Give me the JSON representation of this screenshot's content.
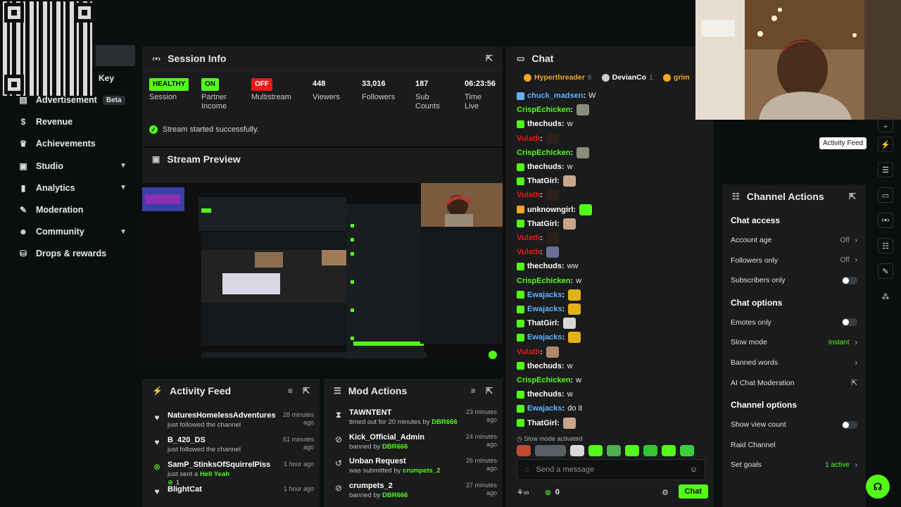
{
  "colors": {
    "accent": "#53fc18",
    "bg": "#0b0e0f",
    "panel": "#191b1c",
    "offline": "#e91916"
  },
  "sidebar": {
    "stream_key": "Key",
    "items": [
      {
        "label": "Advertisement",
        "icon": "advertisement-icon",
        "badge": "Beta"
      },
      {
        "label": "Revenue",
        "icon": "dollar-icon"
      },
      {
        "label": "Achievements",
        "icon": "trophy-icon"
      },
      {
        "label": "Studio",
        "icon": "studio-icon",
        "expandable": true
      },
      {
        "label": "Analytics",
        "icon": "chart-icon",
        "expandable": true
      },
      {
        "label": "Moderation",
        "icon": "wrench-icon"
      },
      {
        "label": "Community",
        "icon": "people-icon",
        "expandable": true
      },
      {
        "label": "Drops & rewards",
        "icon": "gift-icon"
      }
    ]
  },
  "session": {
    "title": "Session Info",
    "stats": [
      {
        "value": "HEALTHY",
        "label": "Session",
        "style": "green"
      },
      {
        "value": "ON",
        "label": "Partner Income",
        "style": "green"
      },
      {
        "value": "OFF",
        "label": "Multistream",
        "style": "red"
      },
      {
        "value": "448",
        "label": "Viewers"
      },
      {
        "value": "33,016",
        "label": "Followers"
      },
      {
        "value": "187",
        "label": "Sub Counts"
      },
      {
        "value": "06:23:56",
        "label": "Time Live"
      }
    ],
    "status": "Stream started successfully."
  },
  "preview": {
    "title": "Stream Preview"
  },
  "activity": {
    "title": "Activity Feed",
    "items": [
      {
        "icon": "heart-icon",
        "name": "NaturesHomelessAdventures",
        "sub": "just followed the channel",
        "time": "28 minutes ago"
      },
      {
        "icon": "heart-icon",
        "name": "B_420_DS",
        "sub": "just followed the channel",
        "time": "51 minutes ago"
      },
      {
        "icon": "kick-icon",
        "name": "SamP_StinksOfSquirrelPiss",
        "sub_prefix": "just sent a ",
        "sub_highlight": "Hell Yeah",
        "extra": "1",
        "time": "1 hour ago"
      },
      {
        "icon": "heart-icon",
        "name": "BlightCat",
        "sub": "",
        "time": "1 hour ago"
      }
    ]
  },
  "mod": {
    "title": "Mod Actions",
    "items": [
      {
        "icon": "hourglass-icon",
        "name": "TAWNTENT",
        "sub_prefix": "timed out for 20 minutes by ",
        "by": "DBR666",
        "time": "23 minutes ago"
      },
      {
        "icon": "ban-icon",
        "name": "Kick_Official_Admin",
        "sub_prefix": "banned by ",
        "by": "DBR666",
        "time": "24 minutes ago"
      },
      {
        "icon": "undo-icon",
        "name": "Unban Request",
        "sub_prefix": "was submitted by ",
        "by": "crumpets_2",
        "time": "26 minutes ago"
      },
      {
        "icon": "ban-icon",
        "name": "crumpets_2",
        "sub_prefix": "banned by ",
        "by": "DBR666",
        "time": "27 minutes ago"
      }
    ]
  },
  "chat": {
    "title": "Chat",
    "top": [
      {
        "name": "Hyperthreader",
        "count": "6",
        "color": "#f5a623"
      },
      {
        "name": "DevianCo",
        "count": "1",
        "color": "#cccccc"
      },
      {
        "name": "grim",
        "count": "",
        "color": "#f5a623"
      }
    ],
    "messages": [
      {
        "user": "chuck_madsen",
        "color": "#5fb3ff",
        "text": "W",
        "badge": "#6ab0ff"
      },
      {
        "user": "CrispEchicken",
        "color": "#53fc18",
        "text": "",
        "emote": "#8c8c7a"
      },
      {
        "user": "thechuds",
        "color": "#ffffff",
        "text": "w",
        "badge": "#53fc18"
      },
      {
        "user": "Vulath",
        "color": "#e91916",
        "text": "",
        "emote": "#2b2019"
      },
      {
        "user": "CrispEchicken",
        "color": "#53fc18",
        "text": "",
        "emote": "#8c8c7a"
      },
      {
        "user": "thechuds",
        "color": "#ffffff",
        "text": "w",
        "badge": "#53fc18"
      },
      {
        "user": "ThatGirl",
        "color": "#ffffff",
        "text": "",
        "emote": "#c9a68a",
        "badge": "#53fc18"
      },
      {
        "user": "Vulath",
        "color": "#e91916",
        "text": "",
        "emote": "#2b2019"
      },
      {
        "user": "unknowngirl",
        "color": "#ffffff",
        "text": "",
        "emote": "#53fc18",
        "badge": "#f5a623"
      },
      {
        "user": "ThatGirl",
        "color": "#ffffff",
        "text": "",
        "emote": "#c9a68a",
        "badge": "#53fc18"
      },
      {
        "user": "Vulath",
        "color": "#e91916",
        "text": "",
        "emote": "#2b2019"
      },
      {
        "user": "Vulath",
        "color": "#e91916",
        "text": "",
        "emote": "#6a6f95"
      },
      {
        "user": "thechuds",
        "color": "#ffffff",
        "text": "ww",
        "badge": "#53fc18"
      },
      {
        "user": "CrispEchicken",
        "color": "#53fc18",
        "text": "w"
      },
      {
        "user": "Ewajacks",
        "color": "#5fb3ff",
        "text": "",
        "emote": "#e3b21a",
        "badge": "#53fc18"
      },
      {
        "user": "Ewajacks",
        "color": "#5fb3ff",
        "text": "",
        "emote": "#e3b21a",
        "badge": "#53fc18"
      },
      {
        "user": "ThatGirl",
        "color": "#ffffff",
        "text": "",
        "emote": "#d8d8d8",
        "badge": "#53fc18"
      },
      {
        "user": "Ewajacks",
        "color": "#5fb3ff",
        "text": "",
        "emote": "#e3b21a",
        "badge": "#53fc18"
      },
      {
        "user": "Vulath",
        "color": "#e91916",
        "text": "",
        "emote": "#b28866"
      },
      {
        "user": "thechuds",
        "color": "#ffffff",
        "text": "w",
        "badge": "#53fc18"
      },
      {
        "user": "CrispEchicken",
        "color": "#53fc18",
        "text": "w"
      },
      {
        "user": "thechuds",
        "color": "#ffffff",
        "text": "w",
        "badge": "#53fc18"
      },
      {
        "user": "Ewajacks",
        "color": "#5fb3ff",
        "text": "do it",
        "badge": "#53fc18"
      },
      {
        "user": "ThatGirl",
        "color": "#ffffff",
        "text": "",
        "emote": "#c9a68a",
        "badge": "#53fc18"
      }
    ],
    "slow_mode": "Slow mode activated",
    "placeholder": "Send a message",
    "kicks": "0",
    "send_label": "Chat"
  },
  "actions": {
    "title": "Channel Actions",
    "sections": [
      {
        "title": "Chat access",
        "rows": [
          {
            "label": "Account age",
            "value": "Off",
            "kind": "arrow"
          },
          {
            "label": "Followers only",
            "value": "Off",
            "kind": "arrow"
          },
          {
            "label": "Subscribers only",
            "kind": "toggle"
          }
        ]
      },
      {
        "title": "Chat options",
        "rows": [
          {
            "label": "Emotes only",
            "kind": "toggle"
          },
          {
            "label": "Slow mode",
            "value": "Instant",
            "kind": "arrow",
            "green": true
          },
          {
            "label": "Banned words",
            "kind": "arrow"
          },
          {
            "label": "AI Chat Moderation",
            "kind": "link"
          }
        ]
      },
      {
        "title": "Channel options",
        "rows": [
          {
            "label": "Show view count",
            "kind": "toggle"
          },
          {
            "label": "Raid Channel",
            "kind": "none"
          },
          {
            "label": "Set goals",
            "value": "1 active",
            "kind": "arrow",
            "green": true
          }
        ]
      }
    ]
  },
  "rail": {
    "tooltip": "Activity Feed"
  }
}
